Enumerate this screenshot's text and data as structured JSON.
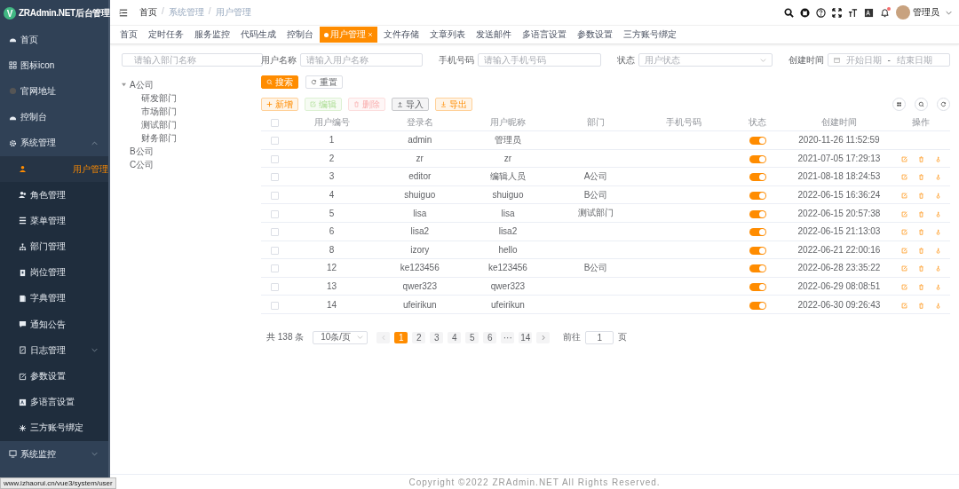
{
  "brand": {
    "logo_letter": "V",
    "title": "ZRAdmin.NET后台管理"
  },
  "sidebar": {
    "items": [
      {
        "label": "首页",
        "selected": false
      },
      {
        "label": "图标icon",
        "selected": false
      },
      {
        "label": "官网地址",
        "selected": false
      },
      {
        "label": "控制台",
        "selected": false
      },
      {
        "label": "系统管理",
        "selected": false,
        "expanded": true,
        "children": [
          {
            "label": "用户管理",
            "selected": true
          },
          {
            "label": "角色管理",
            "selected": false
          },
          {
            "label": "菜单管理",
            "selected": false
          },
          {
            "label": "部门管理",
            "selected": false
          },
          {
            "label": "岗位管理",
            "selected": false
          },
          {
            "label": "字典管理",
            "selected": false
          },
          {
            "label": "通知公告",
            "selected": false
          },
          {
            "label": "日志管理",
            "selected": false,
            "expanded": false
          },
          {
            "label": "参数设置",
            "selected": false
          },
          {
            "label": "多语言设置",
            "selected": false
          },
          {
            "label": "三方账号绑定",
            "selected": false
          }
        ]
      },
      {
        "label": "系统监控",
        "selected": false,
        "expanded": false
      }
    ]
  },
  "status_url": "www.izhaorui.cn/vue3/system/user",
  "breadcrumb": [
    "首页",
    "系统管理",
    "用户管理"
  ],
  "breadcrumb_separator": "/",
  "header": {
    "user": "管理员",
    "has_unread": true
  },
  "tabs": [
    {
      "label": "首页",
      "selected": false
    },
    {
      "label": "定时任务",
      "selected": false
    },
    {
      "label": "服务监控",
      "selected": false
    },
    {
      "label": "代码生成",
      "selected": false
    },
    {
      "label": "控制台",
      "selected": false
    },
    {
      "label": "用户管理",
      "selected": true
    },
    {
      "label": "文件存储",
      "selected": false
    },
    {
      "label": "文章列表",
      "selected": false
    },
    {
      "label": "发送邮件",
      "selected": false
    },
    {
      "label": "多语言设置",
      "selected": false
    },
    {
      "label": "参数设置",
      "selected": false
    },
    {
      "label": "三方账号绑定",
      "selected": false
    }
  ],
  "dept_search": {
    "placeholder": "请输入部门名称"
  },
  "dept_tree": [
    {
      "label": "A公司",
      "expanded": true,
      "children": [
        {
          "label": "研发部门"
        },
        {
          "label": "市场部门"
        },
        {
          "label": "测试部门"
        },
        {
          "label": "财务部门"
        }
      ]
    },
    {
      "label": "B公司"
    },
    {
      "label": "C公司"
    }
  ],
  "filters": {
    "user_name": {
      "label": "用户名称",
      "placeholder": "请输入用户名称"
    },
    "phone": {
      "label": "手机号码",
      "placeholder": "请输入手机号码"
    },
    "status": {
      "label": "状态",
      "placeholder": "用户状态"
    },
    "created": {
      "label": "创建时间",
      "start_placeholder": "开始日期",
      "separator": "-",
      "end_placeholder": "结束日期"
    }
  },
  "search_buttons": [
    "搜索",
    "重置"
  ],
  "toolbar": [
    {
      "kind": "add",
      "label": "新增",
      "disabled": false
    },
    {
      "kind": "edit",
      "label": "编辑",
      "disabled": true
    },
    {
      "kind": "delete",
      "label": "删除",
      "disabled": true
    },
    {
      "kind": "import",
      "label": "导入",
      "disabled": false
    },
    {
      "kind": "export",
      "label": "导出",
      "disabled": false
    }
  ],
  "table": {
    "all_checked": false,
    "columns": [
      "用户编号",
      "登录名",
      "用户昵称",
      "部门",
      "手机号码",
      "状态",
      "创建时间",
      "操作"
    ],
    "rows": [
      {
        "checked": false,
        "id": "1",
        "login": "admin",
        "nickname": "管理员",
        "dept": "",
        "enabled": true,
        "created": "2020-11-26 11:52:59",
        "actions": false
      },
      {
        "checked": false,
        "id": "2",
        "login": "zr",
        "nickname": "zr",
        "dept": "",
        "enabled": true,
        "created": "2021-07-05 17:29:13",
        "actions": true
      },
      {
        "checked": false,
        "id": "3",
        "login": "editor",
        "nickname": "编辑人员",
        "dept": "A公司",
        "enabled": true,
        "created": "2021-08-18 18:24:53",
        "actions": true
      },
      {
        "checked": false,
        "id": "4",
        "login": "shuiguo",
        "nickname": "shuiguo",
        "dept": "B公司",
        "enabled": true,
        "created": "2022-06-15 16:36:24",
        "actions": true
      },
      {
        "checked": false,
        "id": "5",
        "login": "lisa",
        "nickname": "lisa",
        "dept": "测试部门",
        "enabled": true,
        "created": "2022-06-15 20:57:38",
        "actions": true
      },
      {
        "checked": false,
        "id": "6",
        "login": "lisa2",
        "nickname": "lisa2",
        "dept": "",
        "enabled": true,
        "created": "2022-06-15 21:13:03",
        "actions": true
      },
      {
        "checked": false,
        "id": "8",
        "login": "izory",
        "nickname": "hello",
        "dept": "",
        "enabled": true,
        "created": "2022-06-21 22:00:16",
        "actions": true
      },
      {
        "checked": false,
        "id": "12",
        "login": "ke123456",
        "nickname": "ke123456",
        "dept": "B公司",
        "enabled": true,
        "created": "2022-06-28 23:35:22",
        "actions": true
      },
      {
        "checked": false,
        "id": "13",
        "login": "qwer323",
        "nickname": "qwer323",
        "dept": "",
        "enabled": true,
        "created": "2022-06-29 08:08:51",
        "actions": true
      },
      {
        "checked": false,
        "id": "14",
        "login": "ufeirikun",
        "nickname": "ufeirikun",
        "dept": "",
        "enabled": true,
        "created": "2022-06-30 09:26:43",
        "actions": true
      }
    ]
  },
  "pagination": {
    "total": "共 138 条",
    "page_size": "10条/页",
    "pages": [
      {
        "label": "1",
        "selected": true
      },
      {
        "label": "2",
        "selected": false
      },
      {
        "label": "3",
        "selected": false
      },
      {
        "label": "4",
        "selected": false
      },
      {
        "label": "5",
        "selected": false
      },
      {
        "label": "6",
        "selected": false
      },
      {
        "label": "···",
        "selected": false
      },
      {
        "label": "14",
        "selected": false
      }
    ],
    "goto_label": "前往",
    "goto_value": "1",
    "goto_unit": "页"
  },
  "footer": "Copyright ©2022 ZRAdmin.NET All Rights Reserved."
}
